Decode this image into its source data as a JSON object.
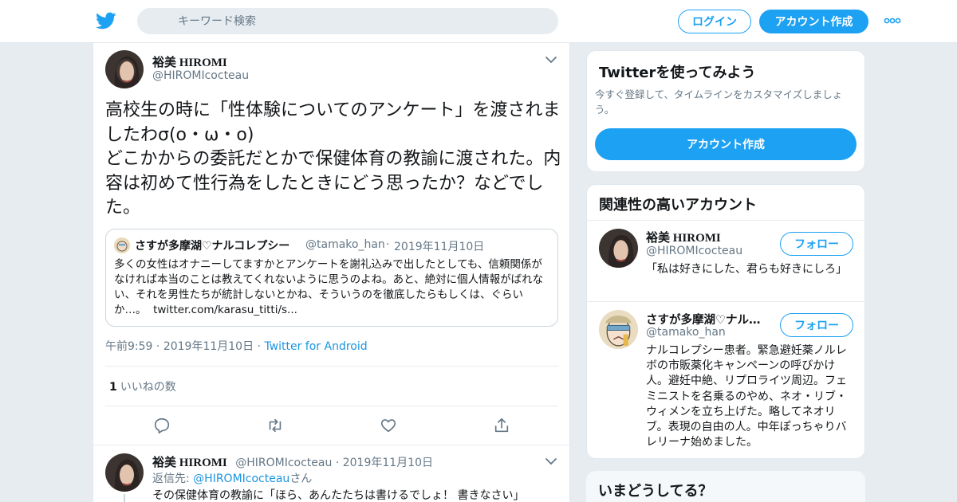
{
  "colors": {
    "brand": "#1da1f2",
    "link": "#1b95e0",
    "muted": "#657786",
    "text": "#14171a",
    "background": "#e6ecf0"
  },
  "header": {
    "logo_icon": "twitter-bird-icon",
    "search_placeholder": "キーワード検索",
    "login_label": "ログイン",
    "signup_label": "アカウント作成",
    "more_icon": "more-dots-icon"
  },
  "tweet": {
    "author_name": "裕美 HIROMI",
    "author_handle": "@HIROMIcocteau",
    "text": "高校生の時に「性体験についてのアンケート」を渡されましたわσ(o・ω・o)\nどこかからの委託だとかで保健体育の教諭に渡された。内容は初めて性行為をしたときにどう思ったか？などでした。",
    "quote": {
      "author_name": "さすが多摩湖♡ナルコレプシー",
      "author_handle": "@tamako_han",
      "separator": "·",
      "date": "2019年11月10日",
      "text": "多くの女性はオナニーしてますかとアンケートを謝礼込みで出したとしても、信頼関係がなければ本当のことは教えてくれないように思うのよね。あと、絶対に個人情報がばれない、それを男性たちが統計しないとかね、そういうのを徹底したらもしくは、ぐらいか…。",
      "link": "twitter.com/karasu_titti/s..."
    },
    "time": "午前9:59",
    "date": "2019年11月10日",
    "separator": "·",
    "source": "Twitter for Android",
    "like_count": "1",
    "like_label": "いいねの数",
    "actions": [
      "reply-icon",
      "retweet-icon",
      "like-icon",
      "share-icon"
    ]
  },
  "reply": {
    "author_name": "裕美 HIROMI",
    "author_handle": "@HIROMIcocteau",
    "separator": "·",
    "date": "2019年11月10日",
    "reply_to_label": "返信先:",
    "reply_to_handle": "@HIROMIcocteau",
    "reply_to_suffix": "さん",
    "text": "その保健体育の教諭に「ほら、あんたたちは書けるでしょ！ 書きなさい」"
  },
  "sidebar": {
    "signup_card": {
      "title": "Twitterを使ってみよう",
      "subtitle": "今すぐ登録して、タイムラインをカスタマイズしましょう。",
      "button_label": "アカウント作成"
    },
    "related_card": {
      "title": "関連性の高いアカウント",
      "follow_label": "フォロー",
      "accounts": [
        {
          "name": "裕美 HIROMI",
          "handle": "@HIROMIcocteau",
          "bio": "「私は好きにした、君らも好きにしろ」"
        },
        {
          "name": "さすが多摩湖♡ナル…",
          "handle": "@tamako_han",
          "bio": "ナルコレプシー患者。緊急避妊薬ノルレボの市販薬化キャンペーンの呼びかけ人。避妊中絶、リプロライツ周辺。フェミニストを名乗るのやめ、ネオ・リブ・ウィメンを立ち上げた。略してネオリブ。表現の自由の人。中年ぽっちゃりバレリーナ始めました。"
        }
      ]
    },
    "trends_card": {
      "title": "いまどうしてる？"
    }
  }
}
